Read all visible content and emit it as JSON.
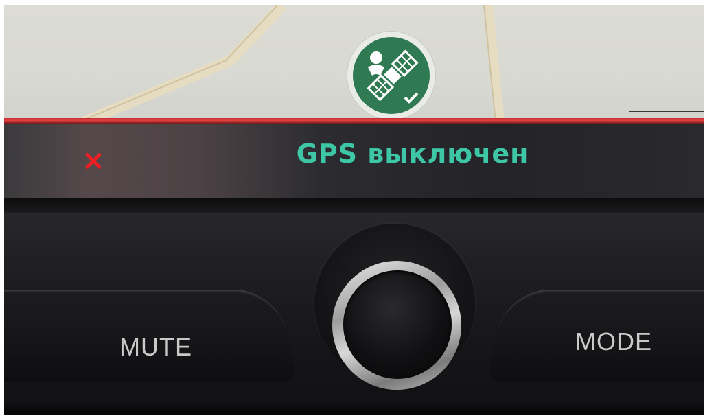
{
  "map": {
    "gps_icon": "satellite-icon",
    "gps_icon_color": "#2f7a52"
  },
  "status_bar": {
    "message": "GPS выключен",
    "message_color": "#3ec7a6",
    "close_symbol": "×",
    "close_color": "#f01e22",
    "accent_line_color": "#e8403f"
  },
  "controls": {
    "mute_label": "MUTE",
    "mode_label": "MODE",
    "knob_icon": "rotary-knob-icon"
  }
}
